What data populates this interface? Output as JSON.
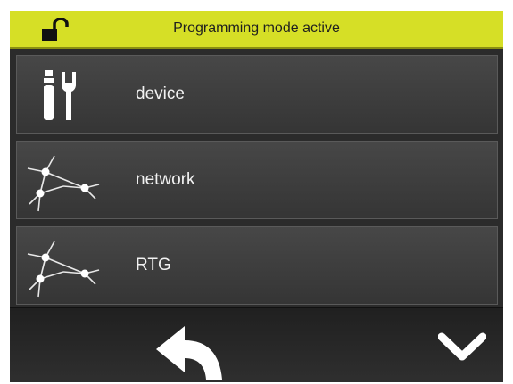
{
  "status_bar": {
    "lock_icon": "unlocked-padlock-icon",
    "text": "Programming mode active",
    "background_color": "#d6df26"
  },
  "menu": {
    "items": [
      {
        "label": "device",
        "icon": "tools-icon"
      },
      {
        "label": "network",
        "icon": "network-nodes-icon"
      },
      {
        "label": "RTG",
        "icon": "network-nodes-icon"
      }
    ]
  },
  "nav": {
    "back_icon": "back-arrow-icon",
    "down_icon": "chevron-down-icon"
  }
}
